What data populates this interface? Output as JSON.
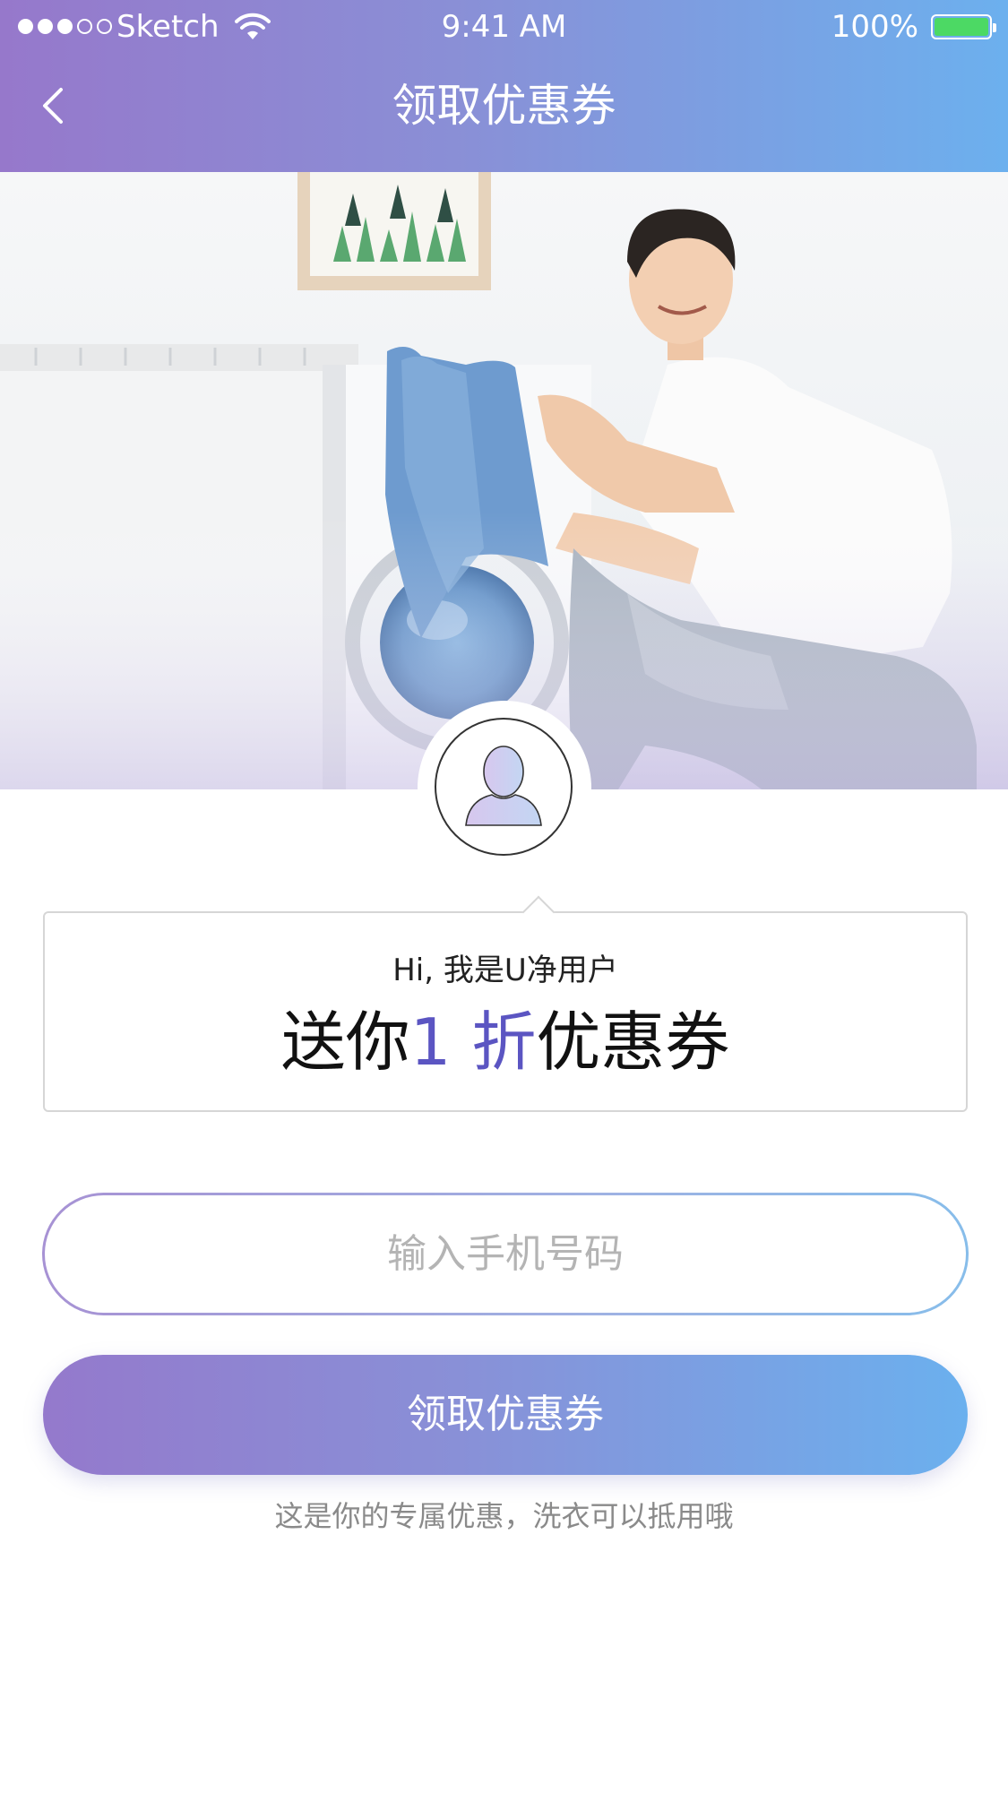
{
  "status_bar": {
    "carrier": "Sketch",
    "time": "9:41 AM",
    "battery": "100%",
    "signal_bars_filled": 3,
    "signal_bars_total": 5,
    "battery_color": "#4cd964"
  },
  "nav": {
    "back_icon": "chevron-left-icon",
    "title": "领取优惠券"
  },
  "card": {
    "greeting": "Hi, 我是U净用户",
    "offer_prefix": "送你",
    "offer_number": "1",
    "offer_unit": "折",
    "offer_suffix": "优惠券",
    "highlight_color": "#5b55c2"
  },
  "phone_input": {
    "placeholder": "输入手机号码",
    "value": ""
  },
  "submit_button": {
    "label": "领取优惠券"
  },
  "footnote": "这是你的专属优惠，洗衣可以抵用哦",
  "colors": {
    "gradient_start": "#9678cb",
    "gradient_end": "#6cb0ee"
  }
}
